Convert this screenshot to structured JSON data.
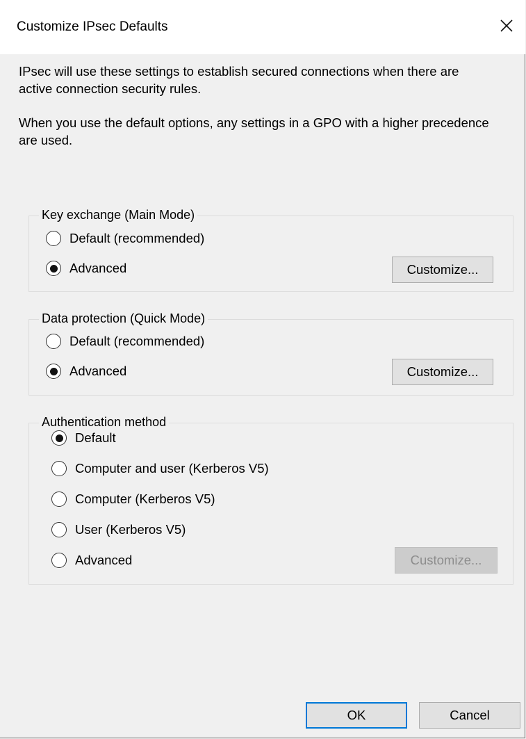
{
  "dialog": {
    "title": "Customize IPsec Defaults",
    "close_label": "✕",
    "intro_line1": "IPsec will use these settings to establish secured connections when there are active connection security rules.",
    "intro_line2": "When you use the default options, any settings in a GPO with a higher precedence are used."
  },
  "key_exchange": {
    "label": "Key exchange (Main Mode)",
    "options": [
      {
        "label": "Default (recommended)",
        "checked": false
      },
      {
        "label": "Advanced",
        "checked": true
      }
    ],
    "customize_label": "Customize...",
    "customize_enabled": true
  },
  "data_protection": {
    "label": "Data protection (Quick Mode)",
    "options": [
      {
        "label": "Default (recommended)",
        "checked": false
      },
      {
        "label": "Advanced",
        "checked": true
      }
    ],
    "customize_label": "Customize...",
    "customize_enabled": true
  },
  "authentication": {
    "label": "Authentication method",
    "options": [
      {
        "label": "Default",
        "checked": true
      },
      {
        "label": "Computer and user (Kerberos V5)",
        "checked": false
      },
      {
        "label": "Computer (Kerberos V5)",
        "checked": false
      },
      {
        "label": "User (Kerberos V5)",
        "checked": false
      },
      {
        "label": "Advanced",
        "checked": false
      }
    ],
    "customize_label": "Customize...",
    "customize_enabled": false
  },
  "footer": {
    "ok_label": "OK",
    "cancel_label": "Cancel"
  }
}
